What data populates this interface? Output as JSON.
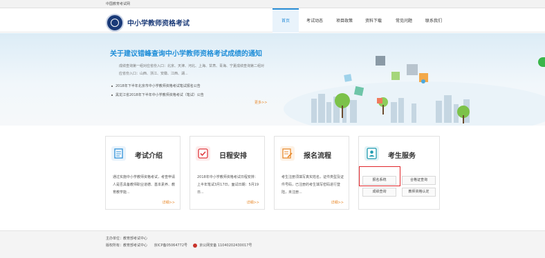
{
  "topbar": {
    "site_name": "中国教育考试网"
  },
  "header": {
    "logo_text": "中小学教师资格考试",
    "nav": [
      "首页",
      "考试动态",
      "项目政策",
      "资料下载",
      "常见问题",
      "联系我们"
    ]
  },
  "banner": {
    "title": "关于建议错峰查询中小学教师资格考试成绩的通知",
    "text": "成绩查询第一组对应省份入口：北京、天津、河北、上海、甘肃、青海、宁夏成绩查询第二组对应省份入口：山西、浙江、安徽、江西、湖...",
    "notices": [
      "2018年下半年北京市中小学教师资格考试笔试报名公告",
      "黑龙江省2018年下半年中小学教师资格考试（笔试）公告"
    ],
    "more": "更多>>"
  },
  "cards": [
    {
      "title": "考试介绍",
      "desc": "通过实施中小学教师资格考试，考查申请人是否具备教师职业道德、基本素养、教育教学能...",
      "more": "详细>>"
    },
    {
      "title": "日程安排",
      "desc": "2018年中小学教师资格考试日程安排：上半年笔试3月17日，面试日期：5月19日...",
      "more": "详细>>"
    },
    {
      "title": "报名流程",
      "desc": "考生注册须填写真实姓名，证件类型及证件号码，已注册的考生填写密码进行登陆，未注册...",
      "more": "详细>>"
    }
  ],
  "service": {
    "title": "考生服务",
    "buttons": [
      "报名系统",
      "合格证查询",
      "成绩查询",
      "教师资格认定"
    ]
  },
  "footer": {
    "line1": "主办单位：教育部考试中心",
    "line2_owner": "版权所有：教育部考试中心",
    "line2_icp": "京ICP备05064772号",
    "line2_police": "京公网安备 11040202430017号"
  },
  "colors": {
    "brand_blue": "#1a3a78",
    "accent_blue": "#2b8fd8",
    "more_orange": "#e8892b",
    "highlight_red": "#e0262b"
  }
}
